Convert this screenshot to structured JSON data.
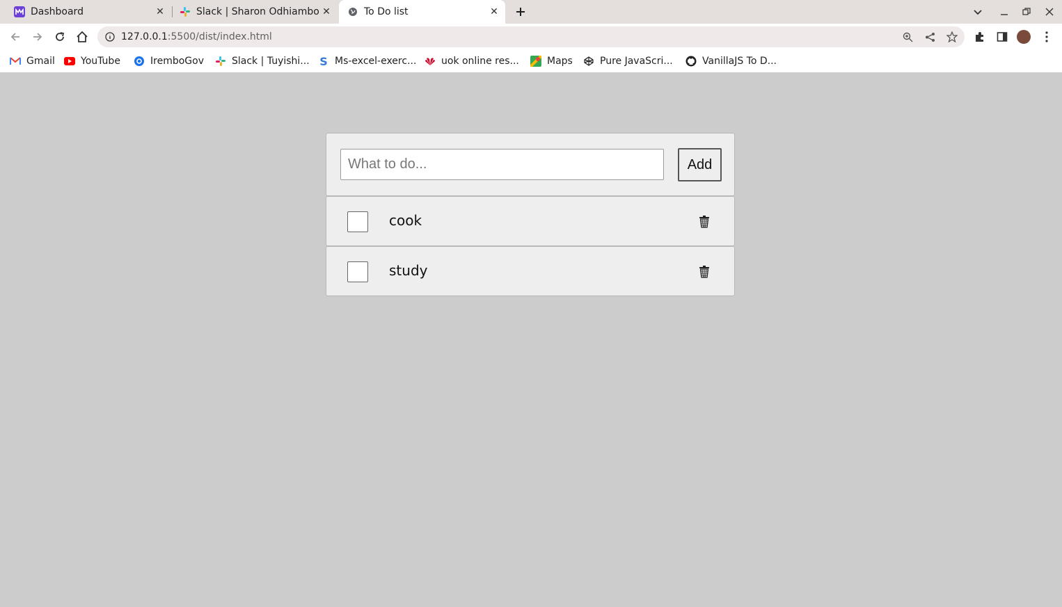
{
  "browser": {
    "tabs": [
      {
        "title": "Dashboard",
        "icon": "dashboard-logo-icon",
        "active": false
      },
      {
        "title": "Slack | Sharon Odhiambo",
        "icon": "slack-icon",
        "active": false
      },
      {
        "title": "To Do list",
        "icon": "globe-icon",
        "active": true
      }
    ],
    "url_host": "127.0.0.1",
    "url_rest": ":5500/dist/index.html",
    "bookmarks": [
      {
        "label": "Gmail",
        "icon": "gmail-icon"
      },
      {
        "label": "YouTube",
        "icon": "youtube-icon"
      },
      {
        "label": "IremboGov",
        "icon": "irembo-icon"
      },
      {
        "label": "Slack | Tuyishi...",
        "icon": "slack-icon"
      },
      {
        "label": "Ms-excel-exerc...",
        "icon": "s-icon"
      },
      {
        "label": "uok online res...",
        "icon": "huawei-icon"
      },
      {
        "label": "Maps",
        "icon": "maps-icon"
      },
      {
        "label": "Pure JavaScri...",
        "icon": "codepen-icon"
      },
      {
        "label": "VanillaJS To D...",
        "icon": "github-icon"
      }
    ]
  },
  "todo": {
    "input_placeholder": "What to do...",
    "input_value": "",
    "add_label": "Add",
    "items": [
      {
        "text": "cook",
        "done": false
      },
      {
        "text": "study",
        "done": false
      }
    ]
  }
}
